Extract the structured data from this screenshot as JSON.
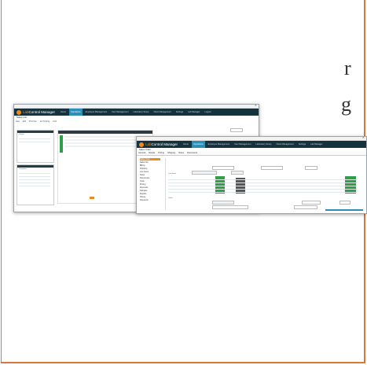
{
  "background": {
    "fragments": [
      "r",
      "g"
    ]
  },
  "back_window": {
    "brand_prefix": "Lab",
    "brand_name": "Control Manager",
    "nav": [
      "Home",
      "Operations",
      "Employee Management",
      "User Management",
      "Laboratory Setup",
      "Client Management",
      "Settings",
      "Lab Manager",
      "Logout",
      "Cart"
    ],
    "active_nav_index": 1,
    "page_title": "Sales List",
    "sections": [
      "Clients",
      "Categories"
    ],
    "toolbar": [
      "New",
      "Edit",
      "Print Nav",
      "Go To Entry",
      "Find"
    ]
  },
  "front_window": {
    "brand_prefix": "Lab",
    "brand_name": "Control Manager",
    "nav": [
      "Home",
      "Operations",
      "Employee Management",
      "User Management",
      "Laboratory Setup",
      "Client Management",
      "Settings",
      "Lab Manager",
      "Logout",
      "Cart"
    ],
    "active_nav_index": 1,
    "page_title": "Sales Order",
    "tabs": [
      "General",
      "Details",
      "Pricing",
      "Shipping",
      "Notes",
      "Documents"
    ],
    "sidebar": [
      "Sales Order",
      "Sales Info",
      "Billing",
      "Shipping",
      "Line Items",
      "Notes",
      "Documents",
      "Tests",
      "Pricing",
      "Discounts",
      "Samples",
      "Reports",
      "History",
      "Payments"
    ],
    "section_labels": [
      "Line Items",
      "Totals"
    ]
  },
  "colors": {
    "accent": "#2c8fb7",
    "appbar": "#16323c",
    "brand": "#f28a1b",
    "frame": "#d9773a",
    "status_green": "#2f9e47"
  }
}
